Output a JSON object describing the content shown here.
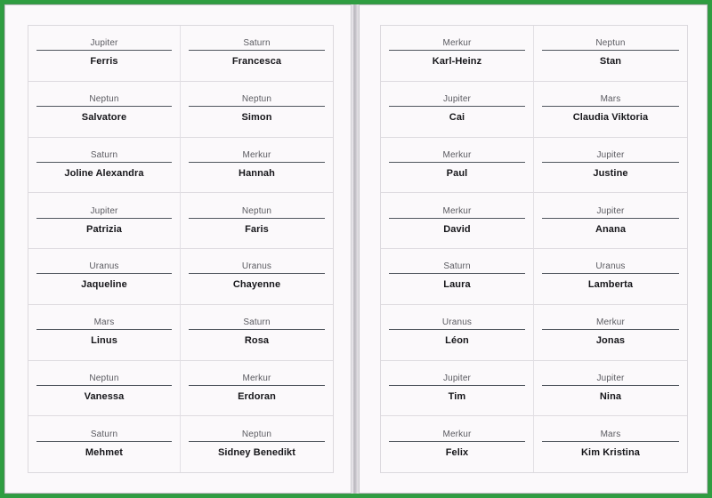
{
  "document": {
    "title": "Name Cards Template Preview",
    "frame_color": "#2f9e41",
    "page_background": "#fbf9fb",
    "rule_color": "#50565e",
    "label_color": "#5a5a60",
    "name_color": "#16161a"
  },
  "pages": [
    {
      "id": "left-page",
      "cards": [
        {
          "planet": "Jupiter",
          "name": "Ferris"
        },
        {
          "planet": "Saturn",
          "name": "Francesca"
        },
        {
          "planet": "Neptun",
          "name": "Salvatore"
        },
        {
          "planet": "Neptun",
          "name": "Simon"
        },
        {
          "planet": "Saturn",
          "name": "Joline Alexandra"
        },
        {
          "planet": "Merkur",
          "name": "Hannah"
        },
        {
          "planet": "Jupiter",
          "name": "Patrizia"
        },
        {
          "planet": "Neptun",
          "name": "Faris"
        },
        {
          "planet": "Uranus",
          "name": "Jaqueline"
        },
        {
          "planet": "Uranus",
          "name": "Chayenne"
        },
        {
          "planet": "Mars",
          "name": "Linus"
        },
        {
          "planet": "Saturn",
          "name": "Rosa"
        },
        {
          "planet": "Neptun",
          "name": "Vanessa"
        },
        {
          "planet": "Merkur",
          "name": "Erdoran"
        },
        {
          "planet": "Saturn",
          "name": "Mehmet"
        },
        {
          "planet": "Neptun",
          "name": "Sidney Benedikt"
        }
      ]
    },
    {
      "id": "right-page",
      "cards": [
        {
          "planet": "Merkur",
          "name": "Karl-Heinz"
        },
        {
          "planet": "Neptun",
          "name": "Stan"
        },
        {
          "planet": "Jupiter",
          "name": "Cai"
        },
        {
          "planet": "Mars",
          "name": "Claudia Viktoria"
        },
        {
          "planet": "Merkur",
          "name": "Paul"
        },
        {
          "planet": "Jupiter",
          "name": "Justine"
        },
        {
          "planet": "Merkur",
          "name": "David"
        },
        {
          "planet": "Jupiter",
          "name": "Anana"
        },
        {
          "planet": "Saturn",
          "name": "Laura"
        },
        {
          "planet": "Uranus",
          "name": "Lamberta"
        },
        {
          "planet": "Uranus",
          "name": "Léon"
        },
        {
          "planet": "Merkur",
          "name": "Jonas"
        },
        {
          "planet": "Jupiter",
          "name": "Tim"
        },
        {
          "planet": "Jupiter",
          "name": "Nina"
        },
        {
          "planet": "Merkur",
          "name": "Felix"
        },
        {
          "planet": "Mars",
          "name": "Kim Kristina"
        }
      ]
    }
  ]
}
